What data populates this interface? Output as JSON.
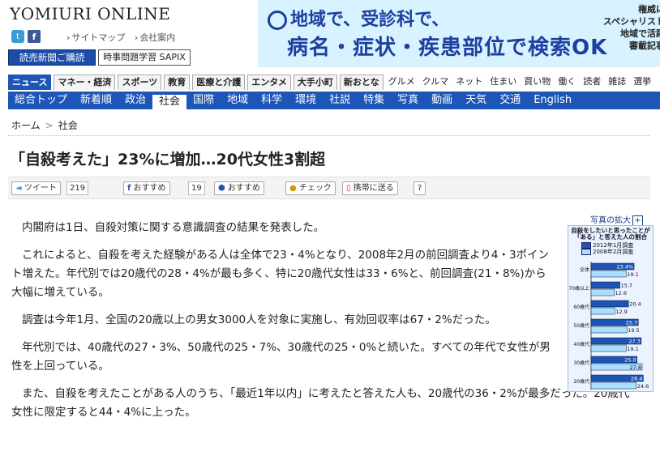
{
  "header": {
    "logo": "YOMIURI ONLINE",
    "links": [
      "サイトマップ",
      "会社案内"
    ],
    "subscribe_button": "読売新聞ご購読",
    "jiji_button": "時事問題学習 SAPIX"
  },
  "ad": {
    "line1": "地域で、受診科で、",
    "line2": "病名・症状・疾患部位で検索OK",
    "side": [
      "権威に",
      "スペシャリスト",
      "地域で活躍",
      "審載記事"
    ]
  },
  "category_tabs": [
    {
      "label": "ニュース",
      "active": true
    },
    {
      "label": "マネー・経済"
    },
    {
      "label": "スポーツ"
    },
    {
      "label": "教育"
    },
    {
      "label": "医療と介護"
    },
    {
      "label": "エンタメ"
    },
    {
      "label": "大手小町"
    },
    {
      "label": "新おとな"
    }
  ],
  "category_plain": [
    "グルメ",
    "クルマ",
    "ネット",
    "住まい",
    "買い物",
    "働く",
    "読者",
    "雑誌",
    "選挙"
  ],
  "subnav": [
    "総合トップ",
    "新着順",
    "政治",
    "社会",
    "国際",
    "地域",
    "科学",
    "環境",
    "社説",
    "特集",
    "写真",
    "動画",
    "天気",
    "交通",
    "English"
  ],
  "subnav_active": "社会",
  "breadcrumb": {
    "home": "ホーム",
    "current": "社会"
  },
  "article": {
    "title": "「自殺考えた」23%に増加…20代女性3割超",
    "share": {
      "tweet": "ツイート",
      "tweet_count": "219",
      "fb_recommend": "おすすめ",
      "fb_count": "19",
      "recommend2": "おすすめ",
      "check": "チェック",
      "mobile": "携帯に送る",
      "help": "?"
    },
    "paragraphs": [
      "内閣府は1日、自殺対策に関する意識調査の結果を発表した。",
      "これによると、自殺を考えた経験がある人は全体で23・4%となり、2008年2月の前回調査より4・3ポイント増えた。年代別では20歳代の28・4%が最も多く、特に20歳代女性は33・6%と、前回調査(21・8%)から大幅に増えている。",
      "調査は今年1月、全国の20歳以上の男女3000人を対象に実施し、有効回収率は67・2%だった。",
      "年代別では、40歳代の27・3%、50歳代の25・7%、30歳代の25・0%と続いた。すべての年代で女性が男性を上回っている。",
      "また、自殺を考えたことがある人のうち、「最近1年以内」に考えたと答えた人も、20歳代の36・2%が最多だった。20歳代女性に限定すると44・4%に上った。"
    ]
  },
  "photo": {
    "enlarge": "写真の拡大"
  },
  "chart_data": {
    "type": "bar",
    "title": "自殺をしたいと思ったことが「ある」と答えた人の割合",
    "categories": [
      "全体",
      "70歳以上",
      "60歳代",
      "50歳代",
      "40歳代",
      "30歳代",
      "20歳代"
    ],
    "series": [
      {
        "name": "2012年1月調査",
        "values": [
          23.4,
          15.7,
          20.4,
          25.7,
          27.3,
          25.0,
          28.4
        ],
        "labels": [
          "23.4%",
          "15.7",
          "20.4",
          "25.7",
          "27.3",
          "25.0",
          "28.4"
        ]
      },
      {
        "name": "2008年2月調査",
        "values": [
          19.1,
          12.6,
          12.9,
          19.5,
          19.1,
          27.8,
          24.6
        ],
        "labels": [
          "19.1",
          "12.6",
          "12.9",
          "19.5",
          "19.1",
          "27.8",
          "24.6"
        ]
      }
    ],
    "xlim": [
      0,
      30
    ],
    "colors": {
      "s1": "#1c54b8",
      "s2": "#a9e0ff"
    }
  }
}
